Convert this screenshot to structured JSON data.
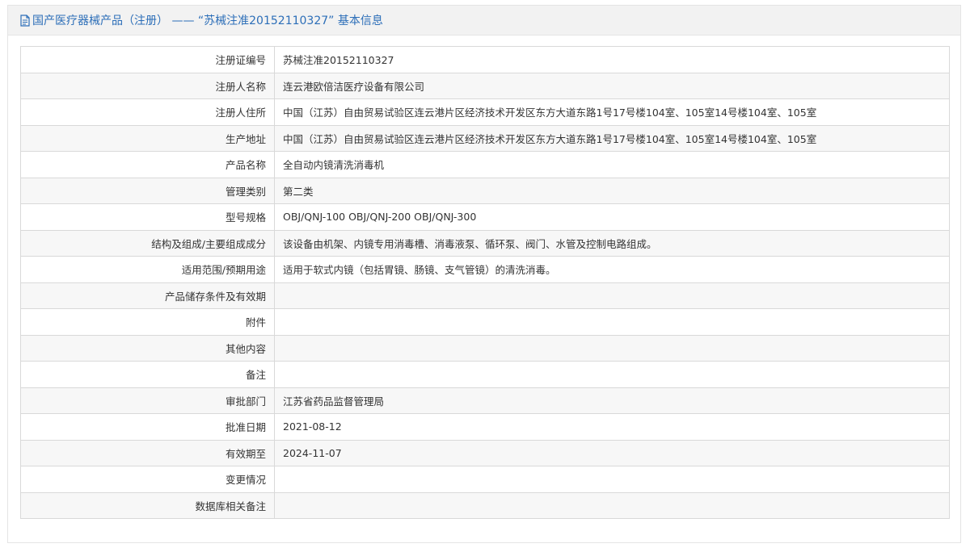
{
  "header": {
    "title": "国产医疗器械产品（注册） —— “苏械注准20152110327” 基本信息"
  },
  "rows": [
    {
      "label": "注册证编号",
      "value": "苏械注准20152110327"
    },
    {
      "label": "注册人名称",
      "value": "连云港欧倍洁医疗设备有限公司"
    },
    {
      "label": "注册人住所",
      "value": "中国（江苏）自由贸易试验区连云港片区经济技术开发区东方大道东路1号17号楼104室、105室14号楼104室、105室"
    },
    {
      "label": "生产地址",
      "value": "中国（江苏）自由贸易试验区连云港片区经济技术开发区东方大道东路1号17号楼104室、105室14号楼104室、105室"
    },
    {
      "label": "产品名称",
      "value": "全自动内镜清洗消毒机"
    },
    {
      "label": "管理类别",
      "value": "第二类"
    },
    {
      "label": "型号规格",
      "value": "OBJ/QNJ-100 OBJ/QNJ-200 OBJ/QNJ-300"
    },
    {
      "label": "结构及组成/主要组成成分",
      "value": "该设备由机架、内镜专用消毒槽、消毒液泵、循环泵、阀门、水管及控制电路组成。"
    },
    {
      "label": "适用范围/预期用途",
      "value": "适用于软式内镜（包括胃镜、肠镜、支气管镜）的清洗消毒。"
    },
    {
      "label": "产品储存条件及有效期",
      "value": ""
    },
    {
      "label": "附件",
      "value": ""
    },
    {
      "label": "其他内容",
      "value": ""
    },
    {
      "label": "备注",
      "value": ""
    },
    {
      "label": "审批部门",
      "value": "江苏省药品监督管理局"
    },
    {
      "label": "批准日期",
      "value": "2021-08-12"
    },
    {
      "label": "有效期至",
      "value": "2024-11-07"
    },
    {
      "label": "变更情况",
      "value": ""
    },
    {
      "label": "数据库相关备注",
      "value": ""
    }
  ]
}
